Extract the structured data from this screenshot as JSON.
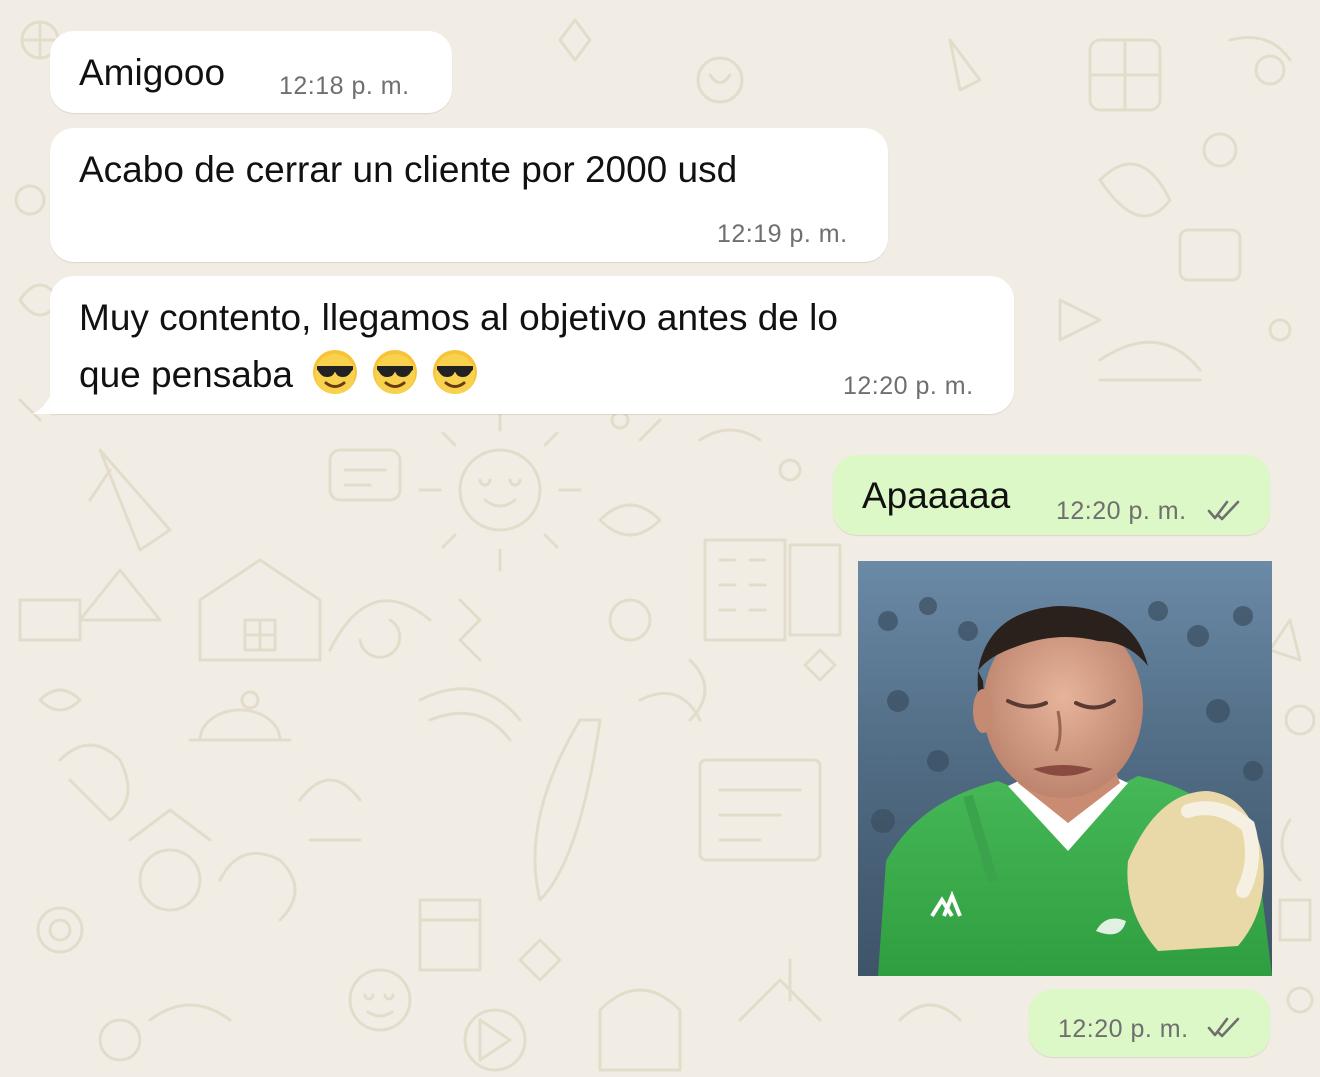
{
  "chat": {
    "messages": [
      {
        "direction": "incoming",
        "text": "Amigooo",
        "time": "12:18 p. m."
      },
      {
        "direction": "incoming",
        "text": "Acabo de cerrar un cliente por 2000 usd",
        "time": "12:19 p. m."
      },
      {
        "direction": "incoming",
        "text_line1": "Muy contento, llegamos al objetivo antes de lo",
        "text_line2": "que pensaba",
        "emojis": [
          "smiling-face-with-sunglasses",
          "smiling-face-with-sunglasses",
          "smiling-face-with-sunglasses"
        ],
        "time": "12:20 p. m."
      },
      {
        "direction": "outgoing",
        "text": "Apaaaaa",
        "time": "12:20 p. m.",
        "status": "read"
      },
      {
        "direction": "outgoing",
        "media": "gif",
        "media_subject": "goalkeeper-in-green-jersey",
        "time": "12:20 p. m.",
        "status": "read"
      }
    ]
  },
  "colors": {
    "wallpaper": "#f2ede4",
    "wallpaper_doodle": "#e4dccb",
    "incoming_bubble": "#ffffff",
    "outgoing_bubble": "#dcf8c6",
    "timestamp": "#6f6f6f",
    "read_ticks": "#6f6f6f"
  },
  "icons": {
    "status_read": "double-check-icon"
  }
}
